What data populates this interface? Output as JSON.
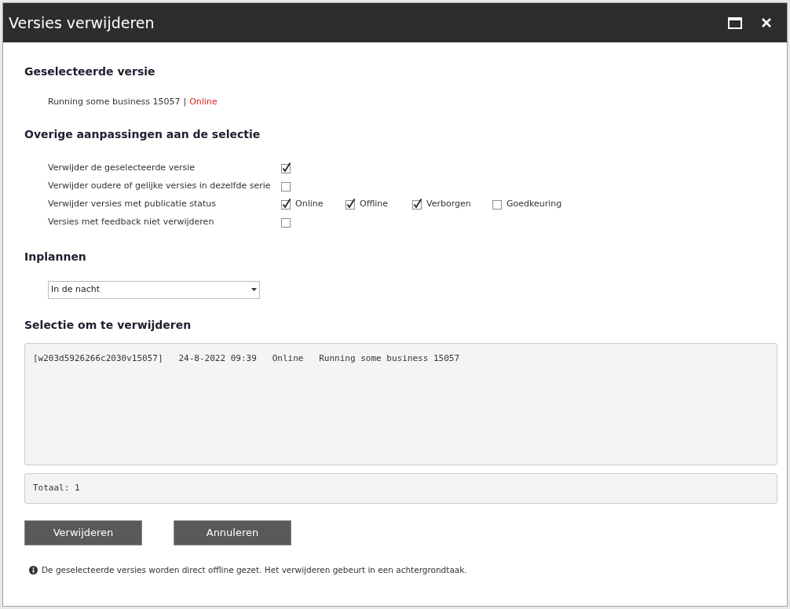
{
  "window": {
    "title": "Versies verwijderen"
  },
  "selected_version": {
    "heading": "Geselecteerde versie",
    "name": "Running some business 15057",
    "separator": "|",
    "status": "Online"
  },
  "options": {
    "heading": "Overige aanpassingen aan de selectie",
    "rows": [
      {
        "kind": "single",
        "label": "Verwijder de geselecteerde versie",
        "checked": true
      },
      {
        "kind": "single",
        "label": "Verwijder oudere of gelijke versies in dezelfde serie",
        "checked": false
      },
      {
        "kind": "multi",
        "label": "Verwijder versies met publicatie status",
        "choices": [
          {
            "label": "Online",
            "checked": true
          },
          {
            "label": "Offline",
            "checked": true
          },
          {
            "label": "Verborgen",
            "checked": true
          },
          {
            "label": "Goedkeuring",
            "checked": false
          }
        ]
      },
      {
        "kind": "single",
        "label": "Versies met feedback niet verwijderen",
        "checked": false
      }
    ]
  },
  "schedule": {
    "heading": "Inplannen",
    "value": "In de nacht"
  },
  "selection": {
    "heading": "Selectie om te verwijderen",
    "lines": [
      "[w203d5926266c2030v15057]   24-8-2022 09:39   Online   Running some business 15057"
    ],
    "total": "Totaal: 1"
  },
  "buttons": [
    "Verwijderen",
    "Annuleren"
  ],
  "info": "De geselecteerde versies worden direct offline gezet. Het verwijderen gebeurt in een achtergrondtaak."
}
